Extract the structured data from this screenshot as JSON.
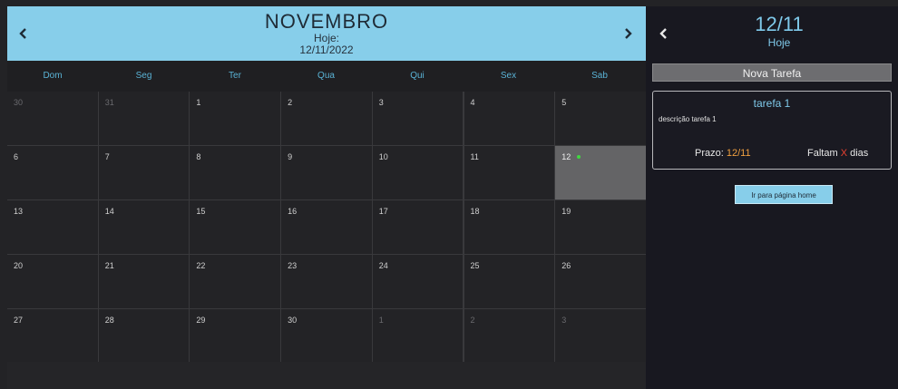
{
  "calendar": {
    "month": "NOVEMBRO",
    "today_label": "Hoje:",
    "today_date": "12/11/2022",
    "weekdays": [
      "Dom",
      "Seg",
      "Ter",
      "Qua",
      "Qui",
      "Sex",
      "Sab"
    ],
    "weeks": [
      [
        {
          "d": "30",
          "other": true
        },
        {
          "d": "31",
          "other": true
        },
        {
          "d": "1"
        },
        {
          "d": "2"
        },
        {
          "d": "3"
        },
        {
          "d": "4"
        },
        {
          "d": "5"
        }
      ],
      [
        {
          "d": "6"
        },
        {
          "d": "7"
        },
        {
          "d": "8"
        },
        {
          "d": "9"
        },
        {
          "d": "10"
        },
        {
          "d": "11"
        },
        {
          "d": "12",
          "selected": true,
          "has_task": true
        }
      ],
      [
        {
          "d": "13"
        },
        {
          "d": "14"
        },
        {
          "d": "15"
        },
        {
          "d": "16"
        },
        {
          "d": "17"
        },
        {
          "d": "18"
        },
        {
          "d": "19"
        }
      ],
      [
        {
          "d": "20"
        },
        {
          "d": "21"
        },
        {
          "d": "22"
        },
        {
          "d": "23"
        },
        {
          "d": "24"
        },
        {
          "d": "25"
        },
        {
          "d": "26"
        }
      ],
      [
        {
          "d": "27"
        },
        {
          "d": "28"
        },
        {
          "d": "29"
        },
        {
          "d": "30"
        },
        {
          "d": "1",
          "other": true
        },
        {
          "d": "2",
          "other": true
        },
        {
          "d": "3",
          "other": true
        }
      ]
    ],
    "icons": {
      "prev": "chevron-left-icon",
      "next": "chevron-right-icon"
    },
    "colors": {
      "header_bg": "#87ceea",
      "selected_day": "#646466",
      "task_dot": "#3fd83f",
      "weekday_text": "#5ab3d6"
    }
  },
  "sidebar": {
    "date": "12/11",
    "label": "Hoje",
    "new_task_label": "Nova Tarefa",
    "task": {
      "title": "tarefa 1",
      "description": "descrição tarefa 1",
      "deadline_label": "Prazo: ",
      "deadline_value": "12/11",
      "remaining_prefix": "Faltam ",
      "remaining_value": "X",
      "remaining_suffix": " dias"
    },
    "home_button_label": "Ir para página home",
    "icons": {
      "prev": "chevron-left-icon"
    }
  }
}
